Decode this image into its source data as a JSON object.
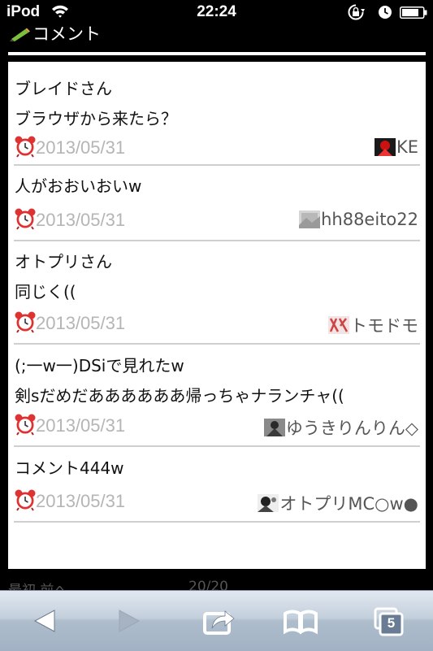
{
  "status_bar": {
    "carrier": "iPod",
    "time": "22:24"
  },
  "header": {
    "title": "コメント"
  },
  "comments": [
    {
      "lines": [
        "ブレイドさん",
        "ブラウザから来たら？"
      ],
      "date": "2013/05/31",
      "user": "KE"
    },
    {
      "lines": [
        "人がおおいおいw"
      ],
      "date": "2013/05/31",
      "user": "hh88eito22"
    },
    {
      "lines": [
        "オトプリさん",
        "同じく(("
      ],
      "date": "2013/05/31",
      "user": "トモドモ"
    },
    {
      "lines": [
        "(;一w一)DSiで見れたw",
        "剣sだめだああああああ帰っちゃナランチャ(("
      ],
      "date": "2013/05/31",
      "user": "ゆうきりんりん◇"
    },
    {
      "lines": [
        "コメント444w"
      ],
      "date": "2013/05/31",
      "user": "オトプリMC○w●"
    }
  ],
  "pager": {
    "left": "最初 前へ",
    "right": "20/20"
  },
  "toolbar": {
    "tabs_count": "5"
  },
  "icons": [
    "back-icon",
    "forward-icon",
    "share-icon",
    "bookmarks-icon",
    "tabs-icon",
    "alarm-clock-icon",
    "pencil-icon",
    "wifi-icon",
    "lock-rotation-icon",
    "clock-icon",
    "battery-icon"
  ]
}
